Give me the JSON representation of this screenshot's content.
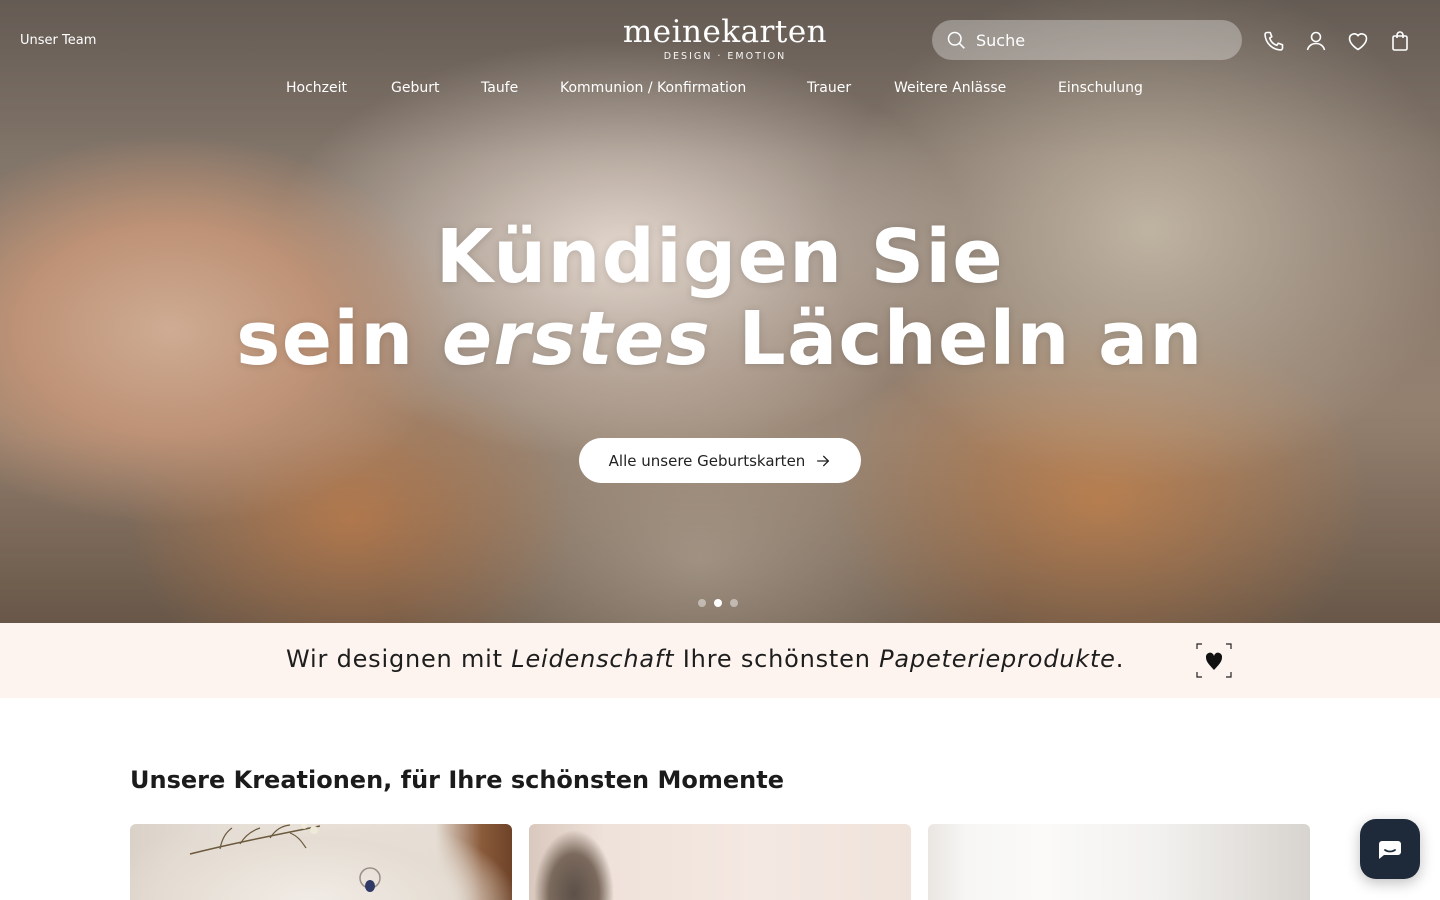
{
  "header": {
    "team_link": "Unser Team",
    "logo": {
      "name": "meinekarten",
      "tagline": "DESIGN · EMOTION"
    },
    "search": {
      "placeholder": "Suche",
      "value": ""
    },
    "icons": [
      "search-icon",
      "phone-icon",
      "user-icon",
      "heart-icon",
      "bag-icon"
    ]
  },
  "nav": {
    "items": [
      {
        "label": "Hochzeit"
      },
      {
        "label": "Geburt"
      },
      {
        "label": "Taufe"
      },
      {
        "label": "Kommunion / Konfirmation"
      },
      {
        "label": "Trauer"
      },
      {
        "label": "Weitere Anlässe"
      },
      {
        "label": "Einschulung"
      }
    ]
  },
  "hero": {
    "line1": "Kündigen Sie",
    "line2_pre": "sein ",
    "line2_em": "erstes",
    "line2_post": " Lächeln an",
    "cta_label": "Alle unsere Geburtskarten",
    "slides": {
      "count": 3,
      "active": 2
    }
  },
  "tagline": {
    "part1": "Wir designen mit ",
    "em1": "Leidenschaft",
    "part2": " Ihre schönsten ",
    "em2": "Papeterieprodukte",
    "part3": "."
  },
  "section": {
    "title": "Unsere Kreationen, für Ihre schönsten Momente"
  },
  "colors": {
    "tagline_band": "#fdf4ef",
    "chat_button": "#1e2a3a",
    "text_dark": "#1b1b1b"
  }
}
